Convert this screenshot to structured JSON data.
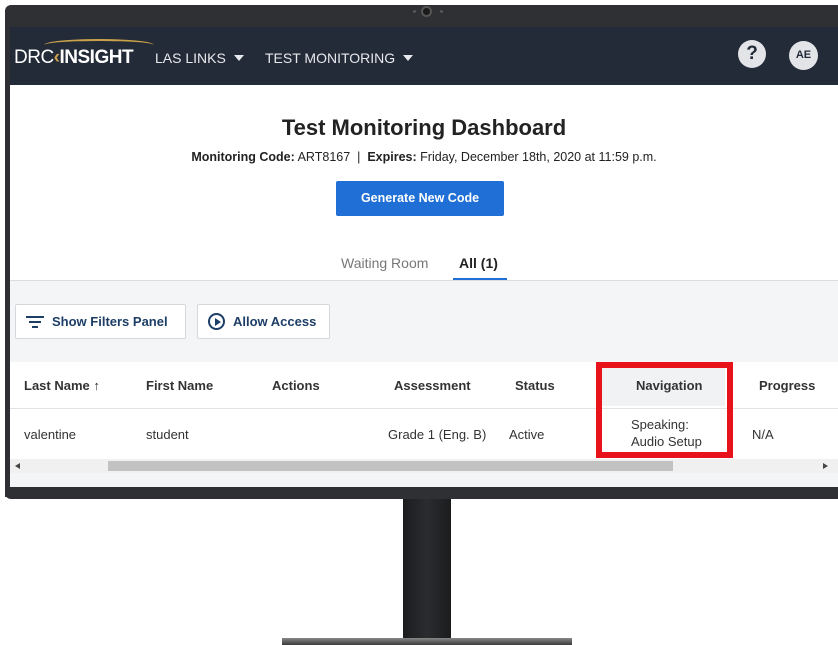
{
  "app": {
    "logo": {
      "drc": "DRC",
      "insight": "INSIGHT"
    },
    "nav": [
      {
        "label": "LAS LINKS"
      },
      {
        "label": "TEST MONITORING"
      }
    ],
    "help_label": "?",
    "avatar_initials": "AE"
  },
  "dashboard": {
    "title": "Test Monitoring Dashboard",
    "monitoring_code_label": "Monitoring Code:",
    "monitoring_code": "ART8167",
    "separator": "|",
    "expires_label": "Expires:",
    "expires_value": "Friday, December 18th, 2020 at 11:59 p.m.",
    "generate_button": "Generate New Code"
  },
  "tabs": [
    {
      "label": "Waiting Room",
      "active": false
    },
    {
      "label": "All (1)",
      "active": true
    }
  ],
  "toolbar": {
    "filters_button": "Show Filters Panel",
    "allow_button": "Allow Access"
  },
  "table": {
    "columns": [
      "Last Name",
      "First Name",
      "Actions",
      "Assessment",
      "Status",
      "Navigation",
      "Progress"
    ],
    "sort_indicator": "↑",
    "rows": [
      {
        "last_name": "valentine",
        "first_name": "student",
        "actions": "",
        "assessment": "Grade 1 (Eng. B)",
        "status": "Active",
        "navigation_line1": "Speaking:",
        "navigation_line2": "Audio Setup",
        "progress": "N/A"
      }
    ]
  },
  "colors": {
    "topbar": "#242b38",
    "primary_button": "#1f6fd6",
    "logo_accent": "#c9a24a",
    "highlight_box": "#e8121a"
  }
}
